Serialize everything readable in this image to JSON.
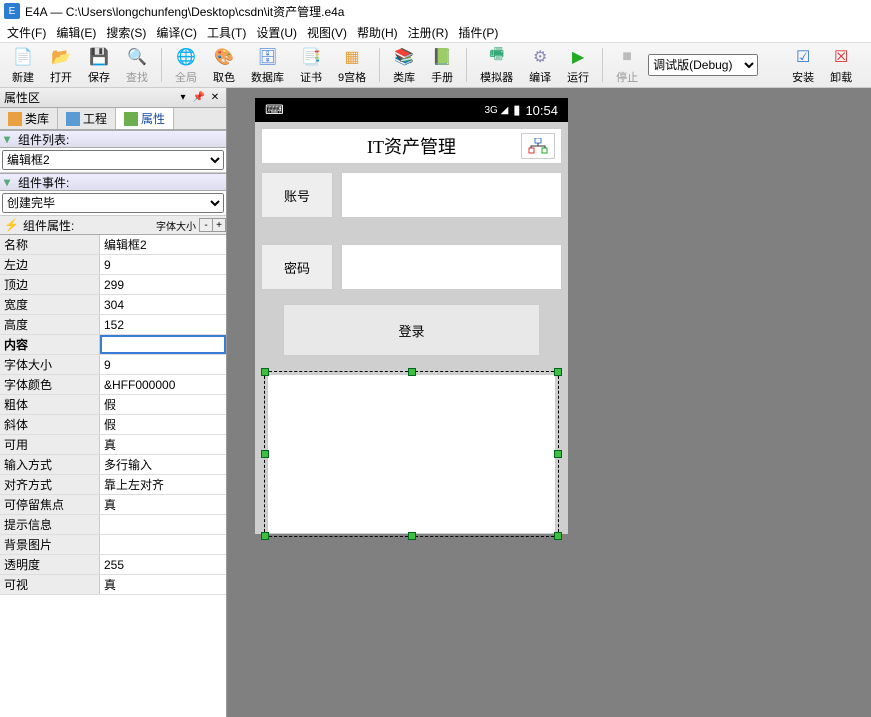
{
  "title": "E4A — C:\\Users\\longchunfeng\\Desktop\\csdn\\it资产管理.e4a",
  "menu": [
    "文件(F)",
    "编辑(E)",
    "搜索(S)",
    "编译(C)",
    "工具(T)",
    "设置(U)",
    "视图(V)",
    "帮助(H)",
    "注册(R)",
    "插件(P)"
  ],
  "toolbar": [
    {
      "label": "新建",
      "icon": "📄",
      "color": "#3a7"
    },
    {
      "label": "打开",
      "icon": "📂",
      "color": "#e8a040"
    },
    {
      "label": "保存",
      "icon": "💾",
      "color": "#3a7bd5"
    },
    {
      "label": "查找",
      "icon": "🔍",
      "color": "#999",
      "disabled": true
    },
    {
      "label": "全局",
      "icon": "🌐",
      "color": "#999",
      "disabled": true
    },
    {
      "label": "取色",
      "icon": "🎨",
      "color": "#d33"
    },
    {
      "label": "数据库",
      "icon": "🗄",
      "color": "#3a7bd5"
    },
    {
      "label": "证书",
      "icon": "📑",
      "color": "#3a7bd5"
    },
    {
      "label": "9宫格",
      "icon": "▦",
      "color": "#e8a040"
    },
    {
      "label": "类库",
      "icon": "📚",
      "color": "#3a7bd5"
    },
    {
      "label": "手册",
      "icon": "📗",
      "color": "#3a7"
    },
    {
      "label": "模拟器",
      "icon": "🖷",
      "color": "#3a7"
    },
    {
      "label": "编译",
      "icon": "⚙",
      "color": "#88b"
    },
    {
      "label": "运行",
      "icon": "▶",
      "color": "#2a2"
    },
    {
      "label": "停止",
      "icon": "■",
      "color": "#999",
      "disabled": true
    },
    {
      "label": "安装",
      "icon": "☑",
      "color": "#3a7bd5"
    },
    {
      "label": "卸载",
      "icon": "☒",
      "color": "#d33"
    }
  ],
  "build_select": "调试版(Debug)",
  "panel": {
    "title": "属性区",
    "tabs": [
      {
        "label": "类库"
      },
      {
        "label": "工程"
      },
      {
        "label": "属性",
        "active": true
      }
    ],
    "component_list": {
      "header": "组件列表:",
      "value": "编辑框2"
    },
    "component_event": {
      "header": "组件事件:",
      "value": "创建完毕"
    },
    "component_prop": {
      "header": "组件属性:",
      "r": "字体大小"
    },
    "rows": [
      {
        "n": "名称",
        "v": "编辑框2"
      },
      {
        "n": "左边",
        "v": "9"
      },
      {
        "n": "顶边",
        "v": "299"
      },
      {
        "n": "宽度",
        "v": "304"
      },
      {
        "n": "高度",
        "v": "152"
      },
      {
        "n": "内容",
        "v": "",
        "sel": true
      },
      {
        "n": "字体大小",
        "v": "9"
      },
      {
        "n": "字体颜色",
        "v": "&HFF000000"
      },
      {
        "n": "粗体",
        "v": "假"
      },
      {
        "n": "斜体",
        "v": "假"
      },
      {
        "n": "可用",
        "v": "真"
      },
      {
        "n": "输入方式",
        "v": "多行输入"
      },
      {
        "n": "对齐方式",
        "v": "靠上左对齐"
      },
      {
        "n": "可停留焦点",
        "v": "真"
      },
      {
        "n": "提示信息",
        "v": ""
      },
      {
        "n": "背景图片",
        "v": ""
      },
      {
        "n": "透明度",
        "v": "255"
      },
      {
        "n": "可视",
        "v": "真"
      }
    ]
  },
  "phone": {
    "time": "10:54",
    "title": "IT资产管理",
    "account": "账号",
    "password": "密码",
    "login": "登录"
  }
}
